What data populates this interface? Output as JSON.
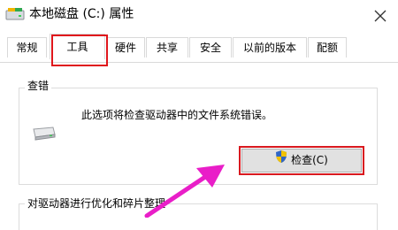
{
  "window": {
    "title": "本地磁盘 (C:) 属性",
    "close_glyph": "✕"
  },
  "tabs": [
    {
      "label": "常规",
      "selected": false
    },
    {
      "label": "工具",
      "selected": true
    },
    {
      "label": "硬件",
      "selected": false
    },
    {
      "label": "共享",
      "selected": false
    },
    {
      "label": "安全",
      "selected": false
    },
    {
      "label": "以前的版本",
      "selected": false
    },
    {
      "label": "配额",
      "selected": false
    }
  ],
  "error_check": {
    "group_title": "查错",
    "description": "此选项将检查驱动器中的文件系统错误。",
    "button_label": "检查(C)"
  },
  "optimize": {
    "group_title": "对驱动器进行优化和碎片整理"
  },
  "colors": {
    "highlight_red": "#e0161c",
    "arrow_magenta": "#e91ec8"
  }
}
